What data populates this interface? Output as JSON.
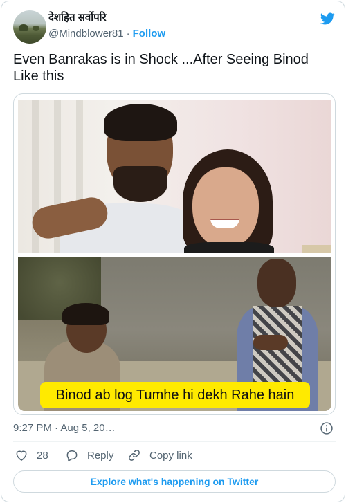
{
  "author": {
    "display_name": "देशहित सर्वोपरि",
    "handle": "@Mindblower81",
    "separator": "·",
    "follow_label": "Follow"
  },
  "tweet": {
    "text": "Even Banrakas is in Shock ...After Seeing Binod Like this",
    "media_caption": "Binod ab log Tumhe hi dekh Rahe hain",
    "time": "9:27 PM",
    "date": "Aug 5, 20…",
    "time_separator": " · "
  },
  "actions": {
    "like_count": "28",
    "reply_label": "Reply",
    "copy_link_label": "Copy link"
  },
  "footer": {
    "explore_label": "Explore what's happening on Twitter"
  },
  "colors": {
    "accent": "#1d9bf0",
    "caption_bg": "#ffea00"
  },
  "icons": {
    "brand": "twitter-bird-icon",
    "info": "info-icon",
    "like": "heart-icon",
    "reply": "speech-bubble-icon",
    "copy": "link-icon"
  }
}
